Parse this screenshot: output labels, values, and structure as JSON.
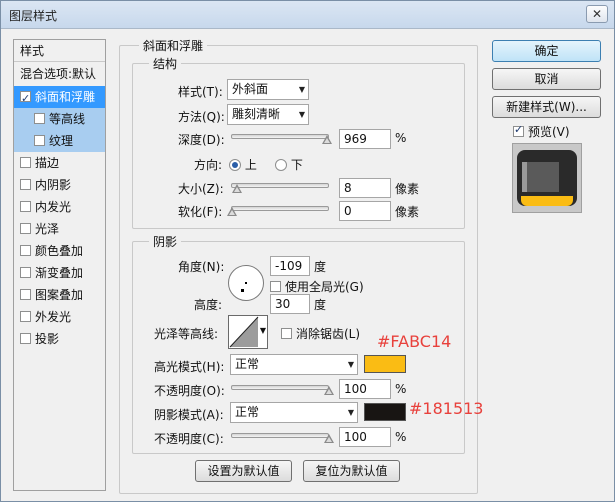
{
  "window": {
    "title": "图层样式",
    "close_glyph": "✕"
  },
  "style_list": {
    "header": "样式",
    "blend_options": "混合选项:默认",
    "items": [
      {
        "label": "斜面和浮雕",
        "checked": true,
        "selected": true
      },
      {
        "label": "等高线",
        "checked": false,
        "sub": true
      },
      {
        "label": "纹理",
        "checked": false,
        "sub": true
      },
      {
        "label": "描边",
        "checked": false
      },
      {
        "label": "内阴影",
        "checked": false
      },
      {
        "label": "内发光",
        "checked": false
      },
      {
        "label": "光泽",
        "checked": false
      },
      {
        "label": "颜色叠加",
        "checked": false
      },
      {
        "label": "渐变叠加",
        "checked": false
      },
      {
        "label": "图案叠加",
        "checked": false
      },
      {
        "label": "外发光",
        "checked": false
      },
      {
        "label": "投影",
        "checked": false
      }
    ]
  },
  "bevel": {
    "group_title": "斜面和浮雕",
    "structure": {
      "title": "结构",
      "style_label": "样式(T):",
      "style_value": "外斜面",
      "technique_label": "方法(Q):",
      "technique_value": "雕刻清晰",
      "depth_label": "深度(D):",
      "depth_value": "969",
      "depth_unit": "%",
      "depth_fraction": 0.97,
      "direction_label": "方向:",
      "direction_up": "上",
      "direction_down": "下",
      "size_label": "大小(Z):",
      "size_value": "8",
      "size_unit": "像素",
      "soften_label": "软化(F):",
      "soften_value": "0",
      "soften_unit": "像素"
    },
    "shading": {
      "title": "阴影",
      "angle_label": "角度(N):",
      "angle_value": "-109",
      "angle_unit": "度",
      "global_light": "使用全局光(G)",
      "altitude_label": "高度:",
      "altitude_value": "30",
      "altitude_unit": "度",
      "gloss_label": "光泽等高线:",
      "anti_alias": "消除锯齿(L)",
      "highlight_label": "高光模式(H):",
      "highlight_mode": "正常",
      "highlight_color": "#FABC14",
      "highlight_opacity_label": "不透明度(O):",
      "highlight_opacity": "100",
      "shadow_label": "阴影模式(A):",
      "shadow_mode": "正常",
      "shadow_color": "#181513",
      "shadow_opacity_label": "不透明度(C):",
      "shadow_opacity": "100",
      "percent": "%"
    },
    "make_default": "设置为默认值",
    "reset_default": "复位为默认值"
  },
  "annotations": {
    "highlight": "#FABC14",
    "shadow": "#181513"
  },
  "buttons": {
    "ok": "确定",
    "cancel": "取消",
    "new_style": "新建样式(W)...",
    "preview": "预览(V)"
  },
  "colors": {
    "accent": "#3399ff",
    "annotation": "#e8413c",
    "preview_bg": "#5a5a5a",
    "preview_yellow": "#fabc14"
  }
}
